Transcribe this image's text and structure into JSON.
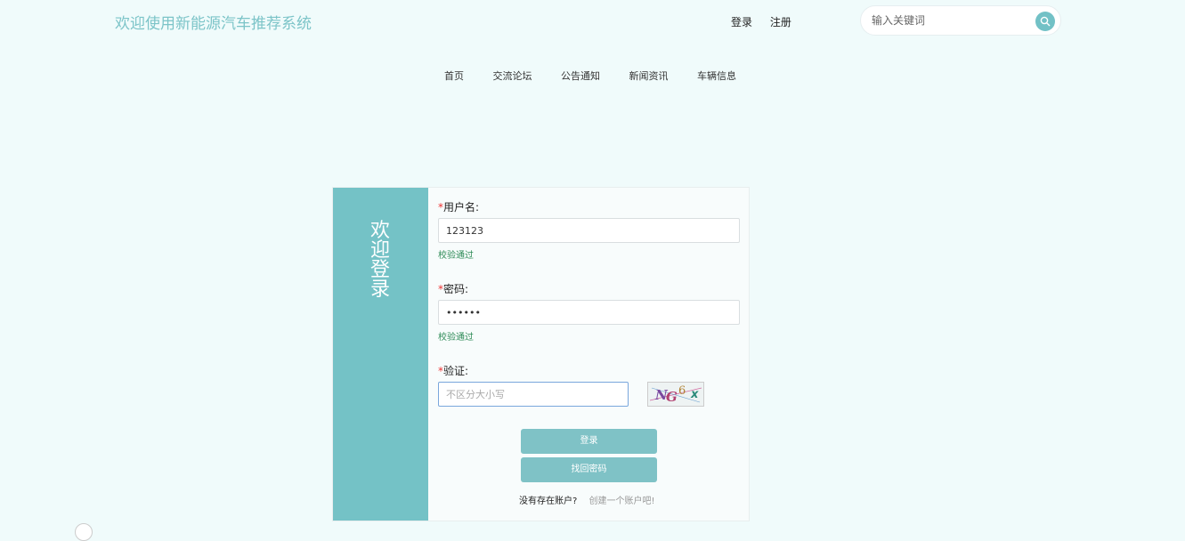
{
  "header": {
    "site_title": "欢迎使用新能源汽车推荐系统",
    "login_link": "登录",
    "register_link": "注册",
    "search_placeholder": "输入关键词",
    "search_icon": "search-icon"
  },
  "nav": {
    "items": [
      "首页",
      "交流论坛",
      "公告通知",
      "新闻资讯",
      "车辆信息"
    ]
  },
  "login_panel": {
    "side_title_chars": [
      "欢",
      "迎",
      "登",
      "录"
    ],
    "required_mark": "*",
    "username_label": "用户名:",
    "username_value": "123123",
    "username_status": "校验通过",
    "password_label": "密码:",
    "password_value": "••••••",
    "password_status": "校验通过",
    "captcha_label": "验证:",
    "captcha_placeholder": "不区分大小写",
    "captcha_image_text": "NG6x",
    "login_button": "登录",
    "forgot_button": "找回密码",
    "no_account_text": "没有存在账户?",
    "create_account_link": "创建一个账户吧!"
  },
  "colors": {
    "accent": "#74c2c6",
    "title": "#7cc4c8",
    "success": "#2e8b57",
    "required": "#e33333",
    "background": "#f0fbfb"
  }
}
